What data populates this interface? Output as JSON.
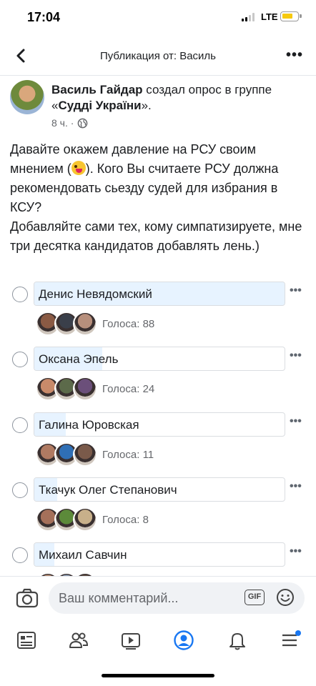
{
  "status": {
    "time": "17:04",
    "network": "LTE"
  },
  "header": {
    "title": "Публикация от: Василь"
  },
  "post": {
    "author": "Василь Гайдар",
    "action": " создал опрос в группе «",
    "group": "Судді України",
    "action_end": "».",
    "time": "8 ч. ·",
    "text_part1": "Давайте окажем давление на РСУ своим мнением (",
    "text_part2": "). Кого Вы считаете РСУ должна рекомендовать сьезду судей для избрания в КСУ?\nДобавляйте сами тех, кому симпатизируете, мне три десятка кандидатов добавлять лень.)"
  },
  "poll": {
    "options": [
      {
        "label": "Денис Невядомский",
        "votes_text": "Голоса: 88",
        "votes": 88,
        "voter_colors": [
          "#8a5a44",
          "#3a3f4a",
          "#b78f7c"
        ]
      },
      {
        "label": "Оксана Эпель",
        "votes_text": "Голоса: 24",
        "votes": 24,
        "voter_colors": [
          "#c98a6a",
          "#5c6a4a",
          "#6b4f7a"
        ]
      },
      {
        "label": "Галина Юровская",
        "votes_text": "Голоса: 11",
        "votes": 11,
        "voter_colors": [
          "#b07a62",
          "#2f6fb5",
          "#7a5a4a"
        ]
      },
      {
        "label": "Ткачук Олег Степанович",
        "votes_text": "Голоса: 8",
        "votes": 8,
        "voter_colors": [
          "#a5705a",
          "#5c8a3a",
          "#c8b08a"
        ]
      },
      {
        "label": "Михаил Савчин",
        "votes_text": "",
        "votes": null,
        "voter_colors": [
          "#b48a70",
          "#8a9ab0",
          "#5a4a40"
        ]
      }
    ]
  },
  "comment": {
    "placeholder": "Ваш комментарий...",
    "gif_label": "GIF"
  },
  "colors": {
    "accent": "#1877f2",
    "poll_fill": "#e7f3ff"
  },
  "tabs": [
    "news-feed-icon",
    "friends-icon",
    "watch-icon",
    "profile-icon",
    "notifications-icon",
    "menu-icon"
  ]
}
